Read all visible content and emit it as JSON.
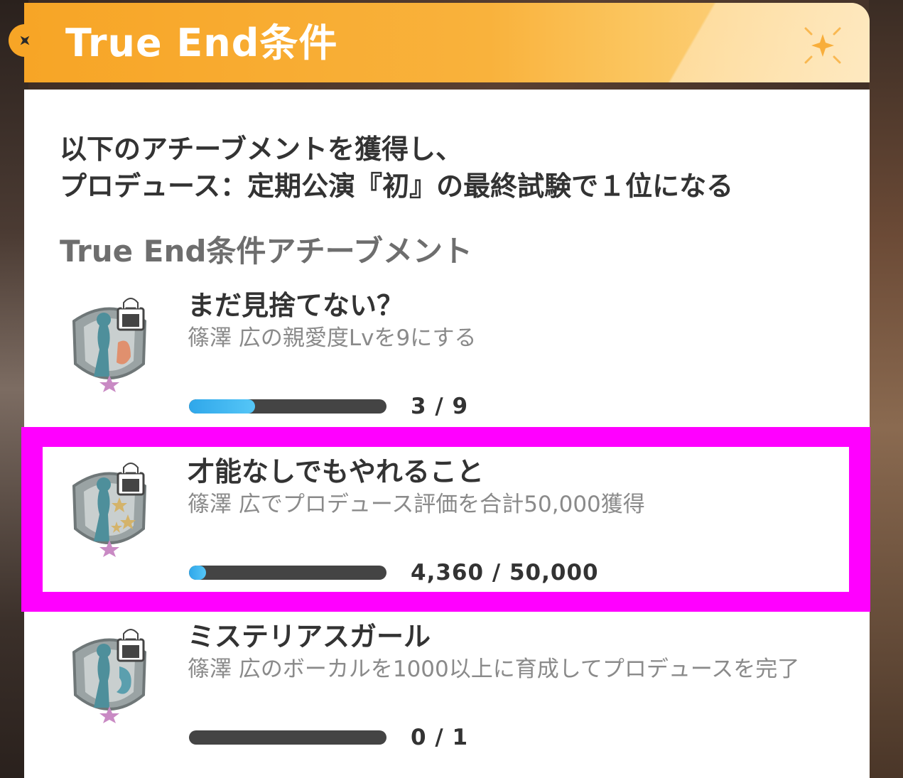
{
  "header": {
    "title": "True End条件",
    "badge_icon": "diamond-sparkle-icon",
    "deco_icon": "sparkle-icon",
    "accent_color": "#f7a526"
  },
  "intro": {
    "line1": "以下のアチーブメントを獲得し、",
    "line2": "プロデュース：定期公演『初』の最終試験で１位になる"
  },
  "section_title": "True End条件アチーブメント",
  "achievements": [
    {
      "name": "まだ見捨てない？",
      "description": "篠澤 広の親愛度Lvを9にする",
      "current": 3,
      "total": 9,
      "progress_text": "3 / 9",
      "icon": "locked-achievement-badge-icon"
    },
    {
      "name": "才能なしでもやれること",
      "description": "篠澤 広でプロデュース評価を合計50,000獲得",
      "current": 4360,
      "total": 50000,
      "progress_text": "4,360 / 50,000",
      "icon": "locked-achievement-badge-icon",
      "highlighted": true
    },
    {
      "name": "ミステリアスガール",
      "description": "篠澤 広のボーカルを1000以上に育成してプロデュースを完了",
      "current": 0,
      "total": 1,
      "progress_text": "0 / 1",
      "icon": "locked-achievement-badge-icon"
    }
  ],
  "colors": {
    "progress_fill": "#2fa7ea",
    "progress_track": "#444444",
    "highlight": "#ff00ff"
  }
}
